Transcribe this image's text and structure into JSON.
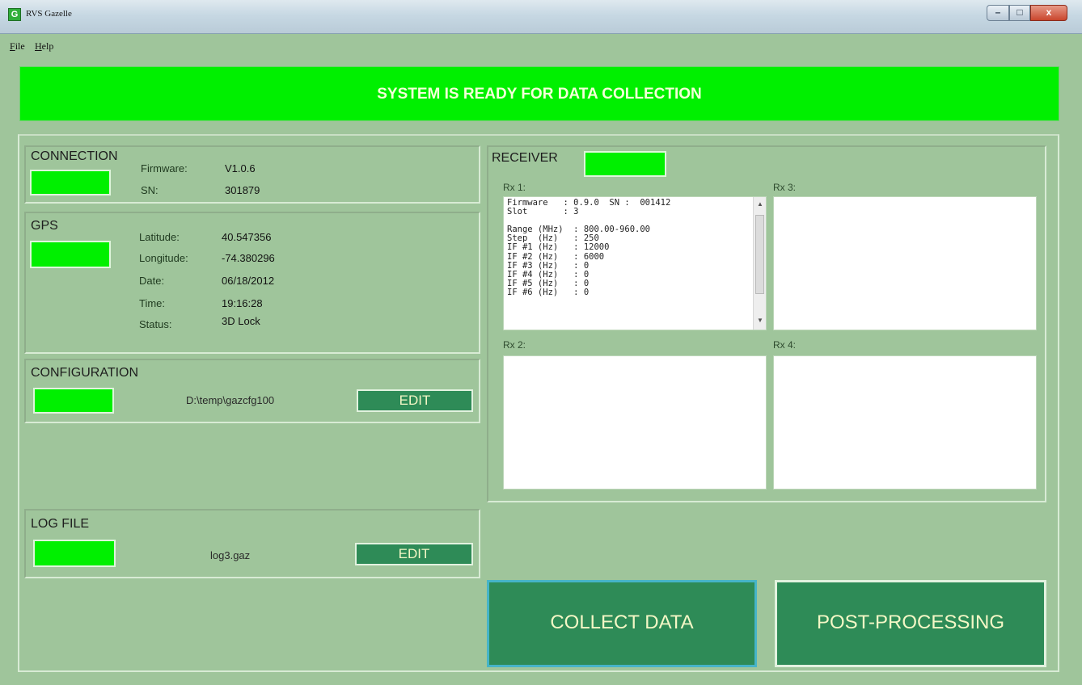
{
  "window": {
    "title": "RVS Gazelle",
    "app_icon_glyph": "G",
    "controls": {
      "minimize": "–",
      "maximize": "□",
      "close": "x"
    }
  },
  "menu": [
    "File",
    "Help"
  ],
  "banner": {
    "text": "SYSTEM IS READY FOR DATA COLLECTION",
    "color": "#00f000"
  },
  "connection": {
    "title": "CONNECTION",
    "firmware_label": "Firmware:",
    "firmware_value": "V1.0.6",
    "sn_label": "SN:",
    "sn_value": "301879"
  },
  "gps": {
    "title": "GPS",
    "rows": [
      {
        "label": "Latitude:",
        "value": "40.547356"
      },
      {
        "label": "Longitude:",
        "value": "-74.380296"
      },
      {
        "label": "Date:",
        "value": "06/18/2012"
      },
      {
        "label": "Time:",
        "value": "19:16:28"
      },
      {
        "label": "Status:",
        "value": "3D Lock"
      }
    ]
  },
  "configuration": {
    "title": "CONFIGURATION",
    "path": "D:\\temp\\gazcfg100",
    "edit_label": "EDIT"
  },
  "logfile": {
    "title": "LOG FILE",
    "path": "log3.gaz",
    "edit_label": "EDIT"
  },
  "receiver": {
    "title": "RECEIVER",
    "rx1": {
      "label": "Rx 1:",
      "lines": [
        "Firmware   : 0.9.0  SN :  001412",
        "Slot       : 3",
        "",
        "Range (MHz)  : 800.00-960.00",
        "Step  (Hz)   : 250",
        "IF #1 (Hz)   : 12000",
        "IF #2 (Hz)   : 6000",
        "IF #3 (Hz)   : 0",
        "IF #4 (Hz)   : 0",
        "IF #5 (Hz)   : 0",
        "IF #6 (Hz)   : 0"
      ]
    },
    "rx2": {
      "label": "Rx 2:"
    },
    "rx3": {
      "label": "Rx 3:"
    },
    "rx4": {
      "label": "Rx 4:"
    }
  },
  "actions": {
    "collect": "COLLECT DATA",
    "post": "POST-PROCESSING"
  },
  "scroll": {
    "up": "▲",
    "down": "▼"
  },
  "colors": {
    "background": "#9fc59b",
    "indicator": "#00f000",
    "button": "#2e8b57",
    "button_text": "#f4f7c6"
  }
}
